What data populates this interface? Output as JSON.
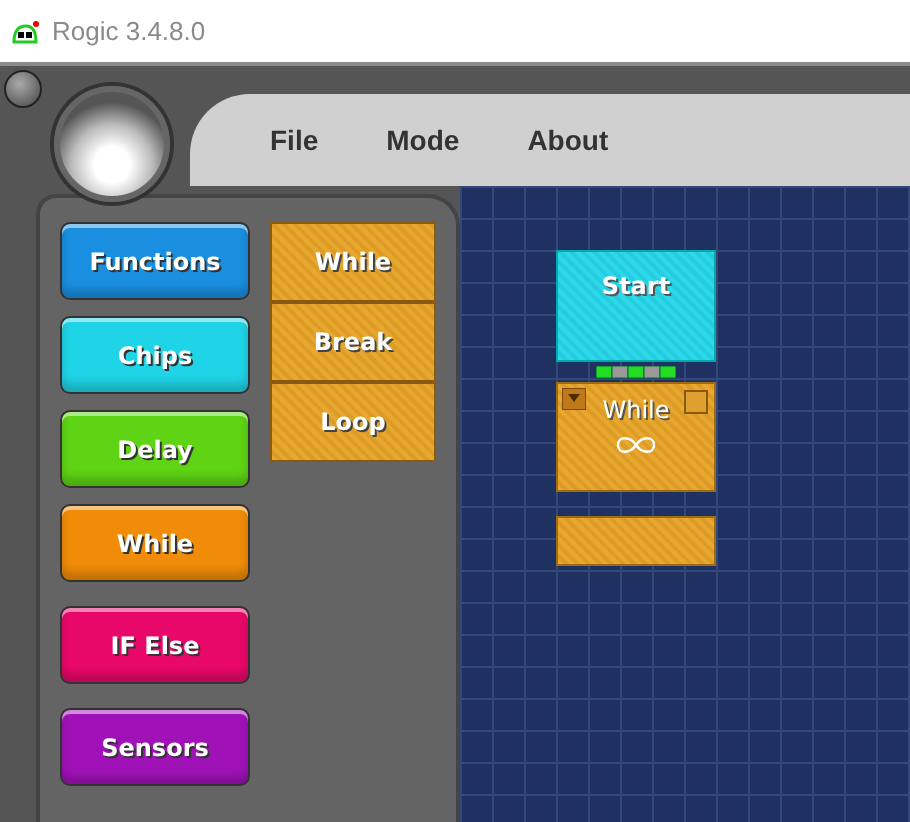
{
  "window": {
    "title": "Rogic 3.4.8.0"
  },
  "menu": [
    "File",
    "Mode",
    "About"
  ],
  "categories": [
    {
      "label": "Functions",
      "color": "#1a8fe0"
    },
    {
      "label": "Chips",
      "color": "#1fd4e6"
    },
    {
      "label": "Delay",
      "color": "#5ed414"
    },
    {
      "label": "While",
      "color": "#f08c08"
    },
    {
      "label": "IF Else",
      "color": "#e8086a"
    },
    {
      "label": "Sensors",
      "color": "#a012b8"
    }
  ],
  "palette": [
    "While",
    "Break",
    "Loop"
  ],
  "canvas": {
    "start_block": "Start",
    "while_block": "While"
  }
}
